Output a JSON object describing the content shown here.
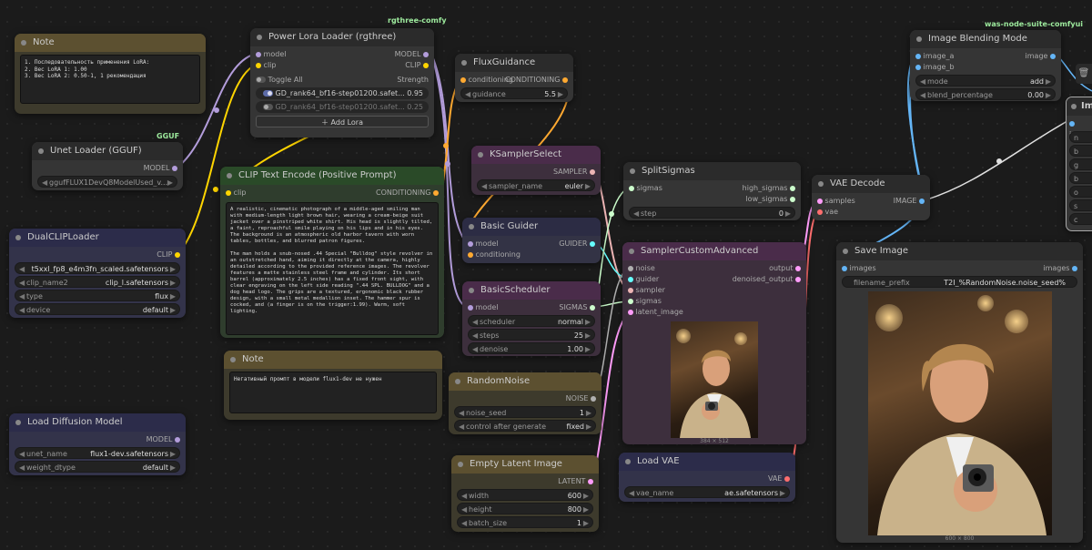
{
  "badges": {
    "rgthree": "rgthree-comfy",
    "gguf": "GGUF",
    "was": "was-node-suite-comfyui"
  },
  "colors": {
    "model": "#b39ddb",
    "clip": "#ffd500",
    "conditioning": "#ffa931",
    "latent": "#ff9cf9",
    "vae": "#ff6e6e",
    "image": "#64b5f6",
    "sigmas": "#cdffcd",
    "sampler": "#ecb4b4",
    "noise": "#b0b0b0",
    "guider": "#66ffff"
  },
  "note1": {
    "title": "Note",
    "text": "1. Последовательность применения LoRA:\n2. Вес LoRA 1: 1.00\n3. Вес LoRA 2: 0.50-1, 1 рекомендация"
  },
  "power_lora": {
    "title": "Power Lora Loader (rgthree)",
    "in_model": "model",
    "in_clip": "clip",
    "out_model": "MODEL",
    "out_clip": "CLIP",
    "toggle_all": "Toggle All",
    "strength": "Strength",
    "loras": [
      {
        "name": "GD_rank64_bf16-step01200.safet...",
        "value": "0.95"
      },
      {
        "name": "GD_rank64_bf16-step01200.safet...",
        "value": "0.25"
      }
    ],
    "add": "＋ Add Lora"
  },
  "flux_guidance": {
    "title": "FluxGuidance",
    "in": "conditioning",
    "out": "CONDITIONING",
    "w_label": "guidance",
    "w_value": "5.5"
  },
  "unet_gguf": {
    "title": "Unet Loader (GGUF)",
    "out": "MODEL",
    "w_value": "ggufFLUX1DevQ8ModelUsed_v..."
  },
  "clip_encode": {
    "title": "CLIP Text Encode (Positive Prompt)",
    "in": "clip",
    "out": "CONDITIONING",
    "text": "A realistic, cinematic photograph of a middle-aged smiling man with medium-length light brown hair, wearing a cream-beige suit jacket over a pinstriped white shirt. His head is slightly tilted, a faint, reproachful smile playing on his lips and in his eyes. The background is an atmospheric old harbor tavern with worn tables, bottles, and blurred patron figures.\n\nThe man holds a snub-nosed .44 Special \"Bulldog\" style revolver in an outstretched hand, aiming it directly at the camera, highly detailed according to the provided reference images. The revolver features a matte stainless steel frame and cylinder. Its short barrel (approximately 2.5 inches) has a fixed front sight, with clear engraving on the left side reading \".44 SPL. BULLDOG\" and a dog head logo. The grips are a textured, ergonomic black rubber design, with a small metal medallion inset. The hammer spur is cocked, and (a finger is on the trigger:1.99). Warm, soft lighting."
  },
  "dual_clip": {
    "title": "DualCLIPLoader",
    "out": "CLIP",
    "widgets": [
      {
        "label": "",
        "value": "t5xxl_fp8_e4m3fn_scaled.safetensors"
      },
      {
        "label": "clip_name2",
        "value": "clip_l.safetensors"
      },
      {
        "label": "type",
        "value": "flux"
      },
      {
        "label": "device",
        "value": "default"
      }
    ]
  },
  "ksampler_select": {
    "title": "KSamplerSelect",
    "out": "SAMPLER",
    "w_label": "sampler_name",
    "w_value": "euler"
  },
  "basic_guider": {
    "title": "Basic Guider",
    "in_model": "model",
    "in_cond": "conditioning",
    "out": "GUIDER"
  },
  "basic_scheduler": {
    "title": "BasicScheduler",
    "in": "model",
    "out": "SIGMAS",
    "widgets": [
      {
        "label": "scheduler",
        "value": "normal"
      },
      {
        "label": "steps",
        "value": "25"
      },
      {
        "label": "denoise",
        "value": "1.00"
      }
    ]
  },
  "note2": {
    "title": "Note",
    "text": "Негативный промпт в модели flux1-dev не нужен"
  },
  "random_noise": {
    "title": "RandomNoise",
    "out": "NOISE",
    "widgets": [
      {
        "label": "noise_seed",
        "value": "1"
      },
      {
        "label": "control after generate",
        "value": "fixed"
      }
    ]
  },
  "empty_latent": {
    "title": "Empty Latent Image",
    "out": "LATENT",
    "widgets": [
      {
        "label": "width",
        "value": "600"
      },
      {
        "label": "height",
        "value": "800"
      },
      {
        "label": "batch_size",
        "value": "1"
      }
    ]
  },
  "load_diffusion": {
    "title": "Load Diffusion Model",
    "out": "MODEL",
    "widgets": [
      {
        "label": "unet_name",
        "value": "flux1-dev.safetensors"
      },
      {
        "label": "weight_dtype",
        "value": "default"
      }
    ]
  },
  "split_sigmas": {
    "title": "SplitSigmas",
    "in": "sigmas",
    "out_high": "high_sigmas",
    "out_low": "low_sigmas",
    "w_label": "step",
    "w_value": "0"
  },
  "sampler_custom": {
    "title": "SamplerCustomAdvanced",
    "inputs": [
      "noise",
      "guider",
      "sampler",
      "sigmas",
      "latent_image"
    ],
    "out1": "output",
    "out2": "denoised_output",
    "caption": "384 × 512"
  },
  "load_vae": {
    "title": "Load VAE",
    "out": "VAE",
    "w_label": "vae_name",
    "w_value": "ae.safetensors"
  },
  "vae_decode": {
    "title": "VAE Decode",
    "in1": "samples",
    "in2": "vae",
    "out": "IMAGE"
  },
  "image_blend": {
    "title": "Image Blending Mode",
    "in1": "image_a",
    "in2": "image_b",
    "out": "image",
    "widgets": [
      {
        "label": "mode",
        "value": "add"
      },
      {
        "label": "blend_percentage",
        "value": "0.00"
      }
    ]
  },
  "save_image": {
    "title": "Save Image",
    "in": "images",
    "out": "images",
    "w_label": "filename_prefix",
    "w_value": "T2I_%RandomNoise.noise_seed%",
    "caption": "600 × 800"
  },
  "partial_node": {
    "title": "Im",
    "rows": [
      "image",
      "n",
      "b",
      "g",
      "b",
      "o",
      "s",
      "c"
    ]
  }
}
